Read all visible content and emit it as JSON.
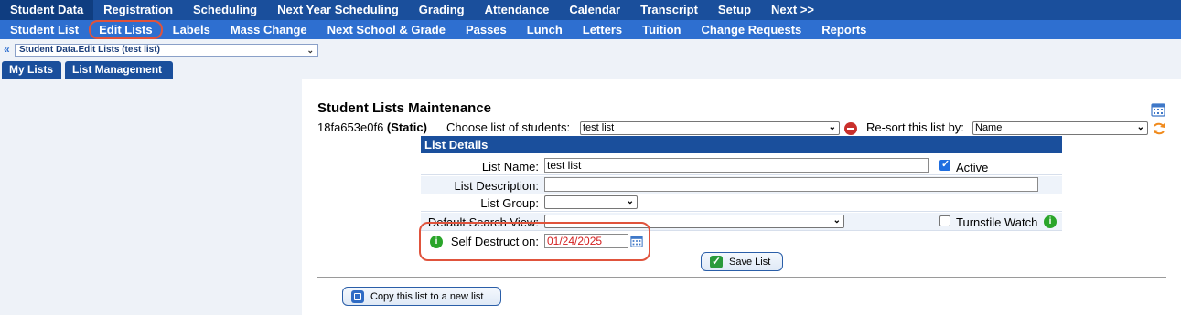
{
  "top_nav": {
    "items": [
      "Student Data",
      "Registration",
      "Scheduling",
      "Next Year Scheduling",
      "Grading",
      "Attendance",
      "Calendar",
      "Transcript",
      "Setup",
      "Next >>"
    ]
  },
  "sub_nav": {
    "items": [
      "Student List",
      "Edit Lists",
      "Labels",
      "Mass Change",
      "Next School & Grade",
      "Passes",
      "Lunch",
      "Letters",
      "Tuition",
      "Change Requests",
      "Reports"
    ]
  },
  "breadcrumb": {
    "arrow": "«",
    "selected": "Student Data.Edit Lists (test list)"
  },
  "tabs": [
    "My Lists",
    "List Management"
  ],
  "page": {
    "title": "Student Lists Maintenance",
    "list_id": "18fa653e0f6",
    "list_type": "(Static)",
    "choose_label": "Choose list of students:",
    "choose_value": "test list",
    "resort_label": "Re-sort this list by:",
    "resort_value": "Name"
  },
  "details": {
    "header": "List Details",
    "name_label": "List Name:",
    "name_value": "test list",
    "active_label": "Active",
    "description_label": "List Description:",
    "description_value": "",
    "group_label": "List Group:",
    "group_value": "",
    "search_view_label": "Default Search View:",
    "search_view_value": "",
    "turnstile_label": "Turnstile Watch",
    "self_destruct_label": "Self Destruct on:",
    "self_destruct_value": "01/24/2025",
    "save_label": "Save List"
  },
  "copy_button": "Copy this list to a new list",
  "colors": {
    "nav_dark": "#1a4f9c",
    "nav_light": "#2e6fd0",
    "highlight": "#e0533c",
    "date_red": "#d42020"
  }
}
